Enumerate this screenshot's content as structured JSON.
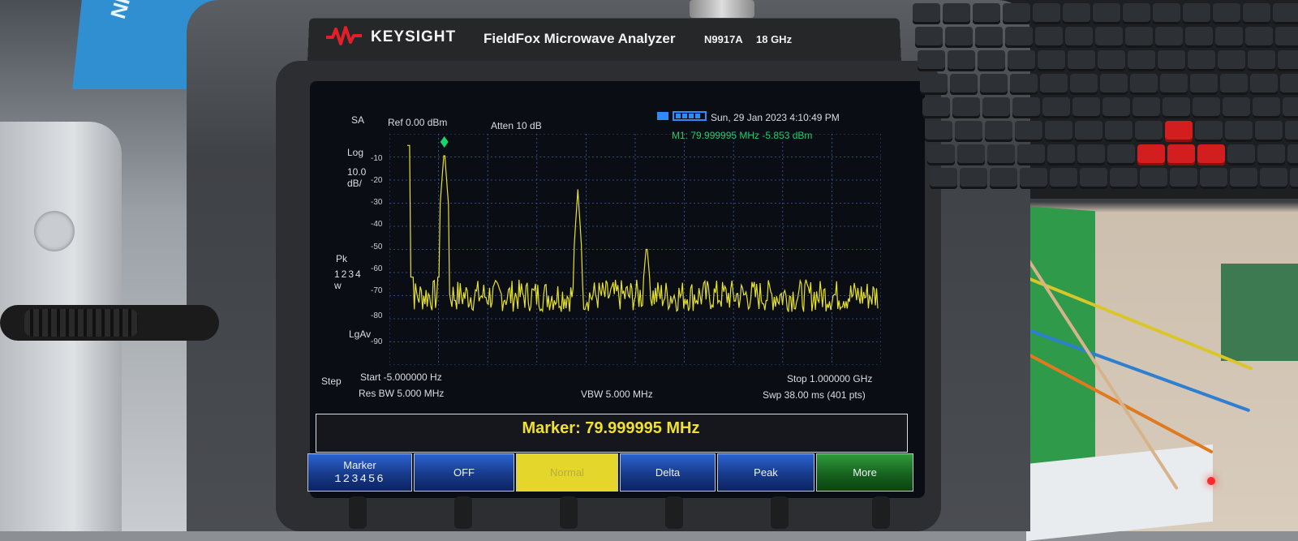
{
  "colors": {
    "trace": "#e6e22a",
    "grid": "#3b5ea8",
    "marker_text": "#f0e030",
    "status_green": "#19d26b",
    "softkey_blue": "#1f4fb0",
    "softkey_yellow": "#e4d62b",
    "softkey_green": "#1f7a2a"
  },
  "background": {
    "box_text": "NITRILE GLOVES"
  },
  "device": {
    "brand": "KEYSIGHT",
    "model_name": "FieldFox Microwave Analyzer",
    "model_number": "N9917A",
    "frequency_range": "18 GHz"
  },
  "screen": {
    "mode": "SA",
    "ref_level": "Ref 0.00 dBm",
    "attenuation": "Atten 10 dB",
    "datetime": "Sun, 29 Jan 2023 4:10:49 PM",
    "marker_line": "M1:  79.999995 MHz  -5.853 dBm",
    "scale_type": "Log",
    "scale_div": "10.0",
    "scale_unit": "dB/",
    "detector": "Pk",
    "trace_numbers": "1234",
    "trace_state": "w",
    "averaging": "LgAv",
    "step_label": "Step",
    "y_ticks": [
      "-10",
      "-20",
      "-30",
      "-40",
      "-50",
      "-60",
      "-70",
      "-80",
      "-90"
    ],
    "start": "Start -5.000000  Hz",
    "stop": "Stop 1.000000 GHz",
    "res_bw": "Res BW 5.000 MHz",
    "vbw": "VBW 5.000 MHz",
    "sweep": "Swp 38.00 ms (401 pts)",
    "marker_readout": "Marker: 79.999995 MHz"
  },
  "softkeys": [
    {
      "label": "Marker",
      "sub": "123456",
      "style": "blue"
    },
    {
      "label": "OFF",
      "sub": "",
      "style": "blue"
    },
    {
      "label": "Normal",
      "sub": "",
      "style": "yellow"
    },
    {
      "label": "Delta",
      "sub": "",
      "style": "blue"
    },
    {
      "label": "Peak",
      "sub": "",
      "style": "blue"
    },
    {
      "label": "More",
      "sub": "",
      "style": "green"
    }
  ]
}
